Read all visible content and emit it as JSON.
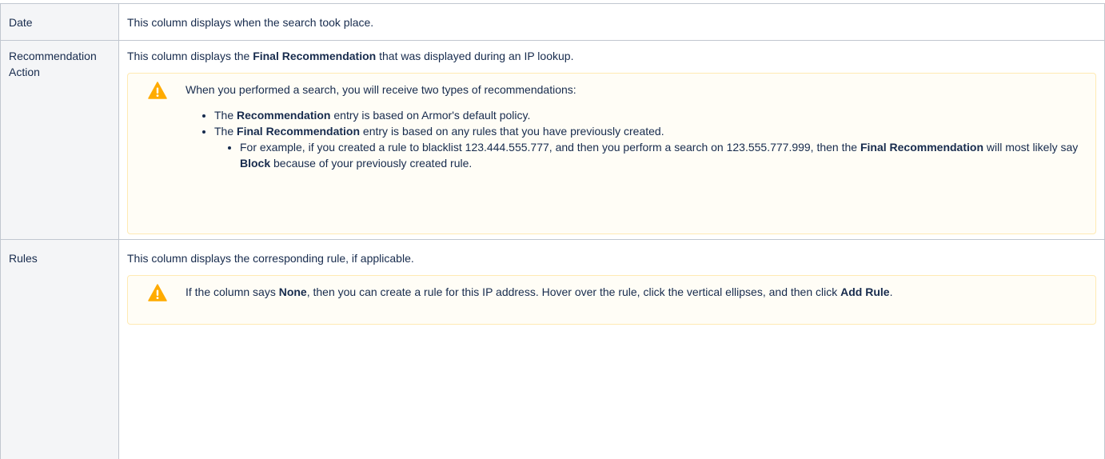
{
  "rows": {
    "date": {
      "key": "Date",
      "desc": "This column displays when the search took place."
    },
    "recommendation": {
      "key": "Recommendation Action",
      "desc_pre": "This column displays the ",
      "desc_bold": "Final Recommendation",
      "desc_post": " that was displayed during an IP lookup.",
      "note": {
        "icon": "warning-icon",
        "intro": "When you performed a search, you will receive two types of recommendations:",
        "bullet1_bold": "Recommendation",
        "bullet1_text": " entry is based on Armor's default policy.",
        "bullet2_bold": "Final Recommendation",
        "bullet2_text": " entry is based on any rules that you have previously created.",
        "the": "The ",
        "sub_pre": "For example, if you created a rule to blacklist 123.444.555.777, and then you perform a search on 123.555.777.999, then the ",
        "sub_bold1": "Final Recommendation",
        "sub_mid": " will most likely say ",
        "sub_bold2": "Block",
        "sub_post": " because of your previously created rule."
      }
    },
    "rules": {
      "key": "Rules",
      "desc": "This column displays the corresponding rule, if applicable.",
      "note": {
        "icon": "warning-icon",
        "pre": "If the column says ",
        "bold1": "None",
        "mid": ", then you can create a rule for this IP address. Hover over the rule, click the vertical ellipses, and then click ",
        "bold2": "Add Rule",
        "post": "."
      }
    }
  },
  "colors": {
    "note_bg": "#fffdf6",
    "note_border": "#ffeab3",
    "warning_fill": "#ffab00",
    "key_bg": "#f4f5f7",
    "border": "#c1c7d0"
  }
}
